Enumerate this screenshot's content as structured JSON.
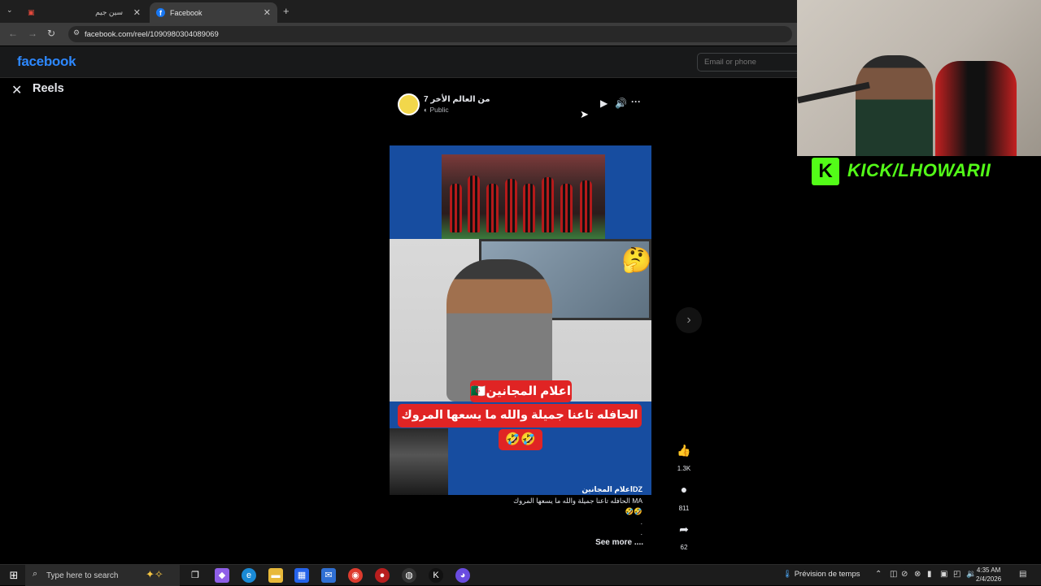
{
  "browser": {
    "tabs": [
      {
        "label": "سين جيم",
        "active": false
      },
      {
        "label": "Facebook",
        "active": true
      }
    ],
    "new_tab": "+",
    "url": "facebook.com/reel/1090980304089069"
  },
  "facebook": {
    "logo": "facebook",
    "email_placeholder": "Email or phone",
    "reels_title": "Reels",
    "post": {
      "page_name": "من العالم الأخر 7",
      "visibility": "Public",
      "video_captions": [
        "اعلام المجانين🇩🇿",
        "الحافله تاعنا جميلة والله ما يسعها المروك🇲🇦",
        "🤣🤣"
      ],
      "video_author_overlay": "اعلام المجانينDZ",
      "description_lines": [
        "الحافله تاعنا جميلة والله ما يسعها المروك MA",
        "🤣🤣",
        ".",
        "."
      ],
      "see_more": "See more ...."
    },
    "actions": {
      "likes": "1.3K",
      "comments": "811",
      "shares": "62"
    }
  },
  "stream": {
    "kick_logo": "K",
    "kick_text": "KICK/LHOWARII"
  },
  "taskbar": {
    "search_placeholder": "Type here to search",
    "weather": "Prévision de temps",
    "time": "4:35 AM",
    "date": "2/4/2026"
  },
  "icons": {
    "close": "close-icon",
    "play": "play-icon",
    "volume": "volume-icon",
    "more": "more-icon",
    "like": "like-icon",
    "comment": "comment-icon",
    "share": "share-icon",
    "next": "chevron-right-icon"
  },
  "colors": {
    "facebook_blue": "#2d88ff",
    "kick_green": "#53fc18",
    "caption_red": "#e02424",
    "video_bg": "#174da0"
  }
}
